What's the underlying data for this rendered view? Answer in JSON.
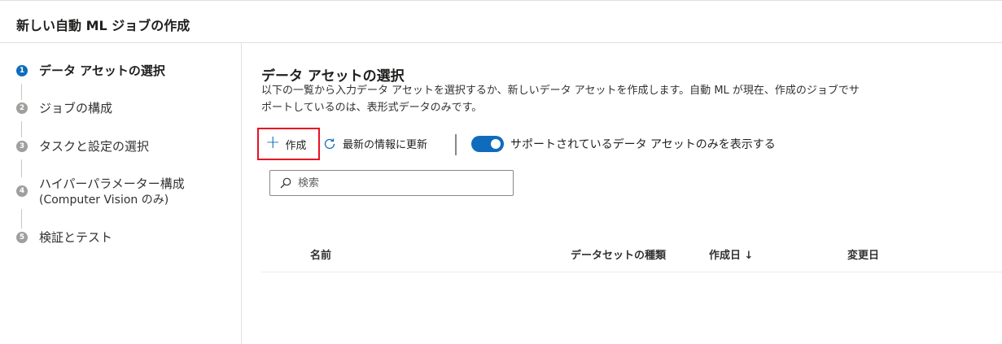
{
  "header": {
    "title": "新しい自動 ML ジョブの作成"
  },
  "steps": [
    {
      "num": "1",
      "label": "データ アセットの選択",
      "active": true
    },
    {
      "num": "2",
      "label": "ジョブの構成"
    },
    {
      "num": "3",
      "label": "タスクと設定の選択"
    },
    {
      "num": "4",
      "label": "ハイパーパラメーター構成",
      "sub": "(Computer Vision のみ)"
    },
    {
      "num": "5",
      "label": "検証とテスト"
    }
  ],
  "main": {
    "title": "データ アセットの選択",
    "description_line1": "以下の一覧から入力データ アセットを選択するか、新しいデータ アセットを作成します。自動 ML が現在、作成のジョブでサ",
    "description_line2": "ポートしているのは、表形式データのみです。"
  },
  "toolbar": {
    "create_label": "作成",
    "refresh_label": "最新の情報に更新",
    "toggle_label": "サポートされているデータ アセットのみを表示する",
    "toggle_on": true
  },
  "search": {
    "placeholder": "検索",
    "value": ""
  },
  "table": {
    "columns": [
      "名前",
      "データセットの種類",
      "作成日 ↓",
      "変更日"
    ]
  },
  "colors": {
    "accent": "#0f6cbd",
    "highlight_border": "#e81123"
  },
  "icons": {
    "create": "plus-icon",
    "refresh": "refresh-icon",
    "search": "search-icon"
  }
}
